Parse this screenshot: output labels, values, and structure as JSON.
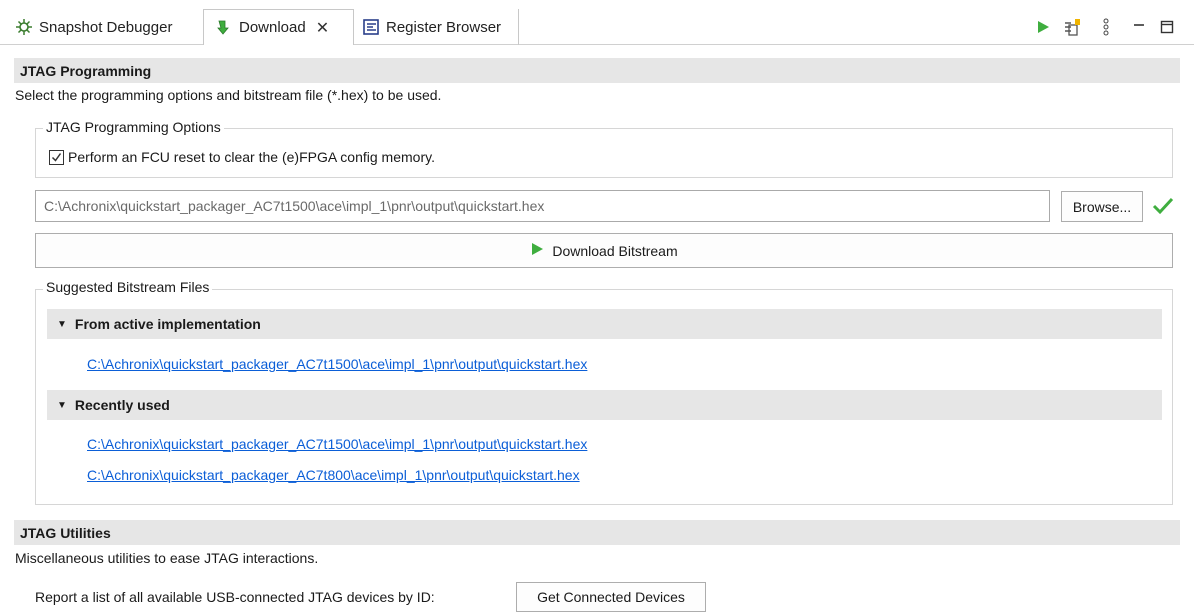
{
  "tabs": [
    {
      "label": "Snapshot Debugger",
      "icon": "snapshot-debugger-icon"
    },
    {
      "label": "Download",
      "icon": "download-icon",
      "active": true,
      "closable": true
    },
    {
      "label": "Register Browser",
      "icon": "register-browser-icon"
    }
  ],
  "toolbar": {
    "icons": [
      "run-icon",
      "export-icon",
      "view-menu-icon",
      "minimize-icon",
      "maximize-icon"
    ]
  },
  "jtag_programming": {
    "header": "JTAG Programming",
    "description": "Select the programming options and bitstream file (*.hex) to be used.",
    "options_group": {
      "legend": "JTAG Programming Options",
      "fcu_reset_label": "Perform an FCU reset to clear the (e)FPGA config memory.",
      "fcu_reset_checked": true
    },
    "bitstream_path": "C:\\Achronix\\quickstart_packager_AC7t1500\\ace\\impl_1\\pnr\\output\\quickstart.hex",
    "browse_label": "Browse...",
    "download_label": "Download Bitstream",
    "suggested": {
      "legend": "Suggested Bitstream Files",
      "active_header": "From active implementation",
      "active_files": [
        "C:\\Achronix\\quickstart_packager_AC7t1500\\ace\\impl_1\\pnr\\output\\quickstart.hex"
      ],
      "recent_header": "Recently used",
      "recent_files": [
        "C:\\Achronix\\quickstart_packager_AC7t1500\\ace\\impl_1\\pnr\\output\\quickstart.hex",
        "C:\\Achronix\\quickstart_packager_AC7t800\\ace\\impl_1\\pnr\\output\\quickstart.hex"
      ]
    }
  },
  "jtag_utilities": {
    "header": "JTAG Utilities",
    "description": "Miscellaneous utilities to ease JTAG interactions.",
    "report_label": "Report a list of all available USB-connected JTAG devices by ID:",
    "get_devices_label": "Get Connected Devices"
  },
  "colors": {
    "accent_green": "#3fae3f",
    "link_blue": "#0b5ed7",
    "header_gray": "#e6e6e6"
  }
}
